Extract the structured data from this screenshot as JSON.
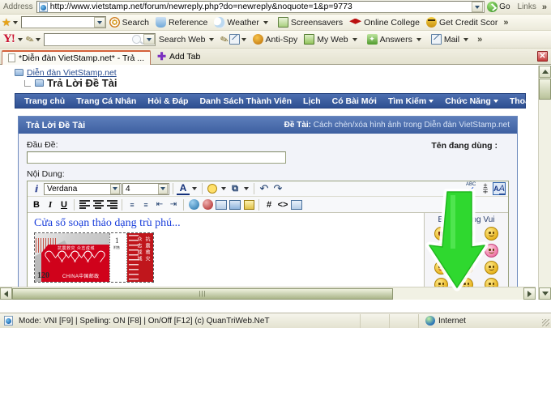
{
  "browser": {
    "address": {
      "label": "Address",
      "url": "http://www.vietstamp.net/forum/newreply.php?do=newreply&noquote=1&p=9773",
      "go_label": "Go",
      "links_label": "Links",
      "overflow": "»"
    },
    "partner_toolbar": {
      "search_value": "",
      "items": [
        {
          "label": "Search",
          "icon": "target-icon"
        },
        {
          "label": "Reference",
          "icon": "reference-icon"
        },
        {
          "label": "Weather",
          "icon": "weather-icon"
        },
        {
          "label": "Screensavers",
          "icon": "screensaver-icon"
        },
        {
          "label": "Online College",
          "icon": "graduation-cap-icon"
        },
        {
          "label": "Get Credit Scor",
          "icon": "bee-icon"
        }
      ],
      "overflow": "»"
    },
    "yahoo_toolbar": {
      "logo": "Y!",
      "search_value": "",
      "search_web_label": "Search Web",
      "items": [
        {
          "label": "Anti-Spy",
          "icon": "antispy-icon"
        },
        {
          "label": "My Web",
          "icon": "myweb-icon"
        },
        {
          "label": "Answers",
          "icon": "answers-icon"
        },
        {
          "label": "Mail",
          "icon": "mail-icon"
        }
      ],
      "overflow": "»"
    },
    "tabs": {
      "active_tab": "*Diễn đàn VietStamp.net* - Trả ...",
      "add_tab_label": "Add Tab",
      "close_label": "✕"
    }
  },
  "page": {
    "breadcrumb": {
      "parent": "Diễn đàn VietStamp.net",
      "current": "Trả Lời Đề Tài"
    },
    "nav": [
      {
        "label": "Trang chủ",
        "caret": false
      },
      {
        "label": "Trang Cá Nhân",
        "caret": false
      },
      {
        "label": "Hỏi & Đáp",
        "caret": false
      },
      {
        "label": "Danh Sách Thành Viên",
        "caret": false
      },
      {
        "label": "Lịch",
        "caret": false
      },
      {
        "label": "Có Bài Mới",
        "caret": false
      },
      {
        "label": "Tìm Kiếm",
        "caret": true
      },
      {
        "label": "Chức Năng",
        "caret": true
      },
      {
        "label": "Thoát",
        "caret": false
      }
    ],
    "panel": {
      "title": "Trả Lời Đề Tài",
      "subject_label": "Đề Tài:",
      "subject_value": "Cách chèn/xóa hình ảnh trong Diễn đàn VietStamp.net",
      "title_field_label": "Đầu Đề:",
      "title_field_value": "",
      "username_label": "Tên đang dùng :",
      "username_value": "",
      "content_label": "Nội Dung:"
    },
    "editor": {
      "font_family": "Verdana",
      "font_size": "4",
      "toolbar_row1": [
        {
          "name": "remove-format-icon",
          "glyph": "✗"
        },
        {
          "name": "font-color-icon",
          "glyph": "A"
        },
        {
          "name": "smiley-icon",
          "glyph": "☺"
        },
        {
          "name": "attachment-icon",
          "glyph": "§"
        },
        {
          "name": "undo-icon",
          "glyph": "↶"
        },
        {
          "name": "redo-icon",
          "glyph": "↷"
        },
        {
          "name": "spellcheck-icon",
          "glyph": "ABC"
        },
        {
          "name": "special-char-icon",
          "glyph": "±"
        },
        {
          "name": "wysiwyg-toggle-icon",
          "glyph": "A/A"
        }
      ],
      "toolbar_row2": [
        {
          "name": "bold-button",
          "glyph": "B"
        },
        {
          "name": "italic-button",
          "glyph": "I"
        },
        {
          "name": "underline-button",
          "glyph": "U"
        },
        {
          "name": "align-left-button",
          "glyph": "≡"
        },
        {
          "name": "align-center-button",
          "glyph": "≡"
        },
        {
          "name": "align-right-button",
          "glyph": "≡"
        },
        {
          "name": "ordered-list-button",
          "glyph": "1."
        },
        {
          "name": "unordered-list-button",
          "glyph": "•"
        },
        {
          "name": "outdent-button",
          "glyph": "⇤"
        },
        {
          "name": "indent-button",
          "glyph": "⇥"
        },
        {
          "name": "insert-link-button",
          "glyph": "●"
        },
        {
          "name": "remove-link-button",
          "glyph": "●"
        },
        {
          "name": "insert-email-button",
          "glyph": "✉"
        },
        {
          "name": "insert-image-button",
          "glyph": "▣"
        },
        {
          "name": "quote-button",
          "glyph": "“"
        },
        {
          "name": "hash-button",
          "glyph": "#"
        },
        {
          "name": "code-button",
          "glyph": "<>"
        },
        {
          "name": "insert-media-button",
          "glyph": "▤"
        }
      ],
      "content_text": "Cửa sổ soạn thảo dạng trù phú...",
      "content_color": "#1b3fdb",
      "stamp": {
        "denomination": "120",
        "country": "CHINA中国邮政",
        "caption": "抗震救灾 众志成城",
        "tab_number": "1",
        "tab_sub": "附售",
        "side_text_1": "抗震救灾",
        "side_text_2": "众志成城"
      }
    },
    "smilies": {
      "title": "Biểu Tượng Vui",
      "items": [
        {
          "name": "smiley-laugh",
          "variant": "open"
        },
        {
          "name": "smiley-neutral",
          "variant": ""
        },
        {
          "name": "smiley-wave",
          "variant": ""
        },
        {
          "name": "smiley-glasses",
          "variant": ""
        },
        {
          "name": "smiley-surprised",
          "variant": ""
        },
        {
          "name": "smiley-angry",
          "variant": "pink"
        },
        {
          "name": "smiley-kiss",
          "variant": "red"
        },
        {
          "name": "smiley-dizzy",
          "variant": ""
        },
        {
          "name": "smiley-happy",
          "variant": ""
        },
        {
          "name": "smiley-tongue",
          "variant": ""
        },
        {
          "name": "smiley-blush",
          "variant": ""
        },
        {
          "name": "smiley-grin",
          "variant": ""
        },
        {
          "name": "smiley-cool",
          "variant": ""
        },
        {
          "name": "smiley-sad",
          "variant": ""
        },
        {
          "name": "smiley-wink",
          "variant": ""
        }
      ]
    },
    "annotation": {
      "arrow_color": "#2fd82f",
      "arrow_label": "pointer-arrow"
    },
    "scrollbar": {
      "h_marker": "|||"
    }
  },
  "status_bar": {
    "text": "Mode: VNI [F9] | Spelling: ON [F8] | On/Off [F12] (c) QuanTriWeb.NeT",
    "zone": "Internet"
  }
}
